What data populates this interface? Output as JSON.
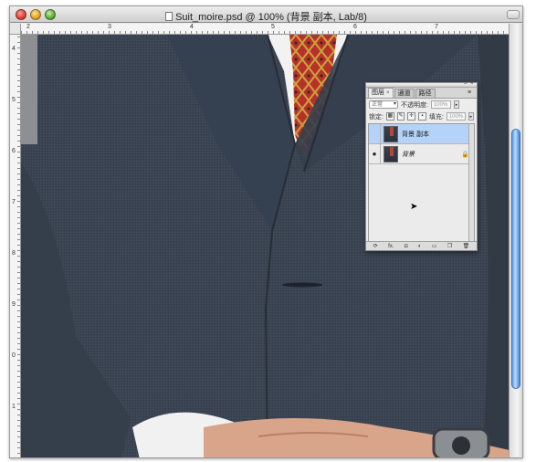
{
  "window": {
    "title": "Suit_moire.psd @ 100% (背景 副本, Lab/8)",
    "ruler_top_labels": [
      "2",
      "3",
      "4",
      "5",
      "6",
      "7"
    ],
    "ruler_left_labels": [
      "4",
      "5",
      "6",
      "7",
      "8",
      "9",
      "0",
      "1"
    ]
  },
  "canvas": {
    "description_colors": {
      "suit": "#3b4452",
      "shirt": "#f2f2f2",
      "tie": "#b8302a",
      "skin": "#d8a58a"
    }
  },
  "layers_palette": {
    "tabs": [
      {
        "label": "图层",
        "close": "×",
        "active": true
      },
      {
        "label": "通道",
        "active": false
      },
      {
        "label": "路径",
        "active": false
      }
    ],
    "menu_icon": "palette-menu-icon",
    "blend_mode": "正常",
    "opacity_label": "不透明度:",
    "opacity_value": "100%",
    "lock_label": "锁定:",
    "fill_label": "填充:",
    "fill_value": "100%",
    "layers": [
      {
        "name": "背景 副本",
        "visible": false,
        "selected": true,
        "italic": false,
        "locked": false
      },
      {
        "name": "背景",
        "visible": true,
        "selected": false,
        "italic": true,
        "locked": true
      }
    ],
    "footer_buttons": [
      "link-icon",
      "fx-icon",
      "mask-icon",
      "adjustment-icon",
      "group-icon",
      "new-layer-icon",
      "trash-icon"
    ],
    "footer_glyphs": [
      "⟳",
      "fx.",
      "◘",
      "◐",
      "▭",
      "❐",
      "🗑"
    ]
  },
  "colors": {
    "selected_layer": "#b5d3f8",
    "scroll_thumb": "#5d9ee6"
  }
}
